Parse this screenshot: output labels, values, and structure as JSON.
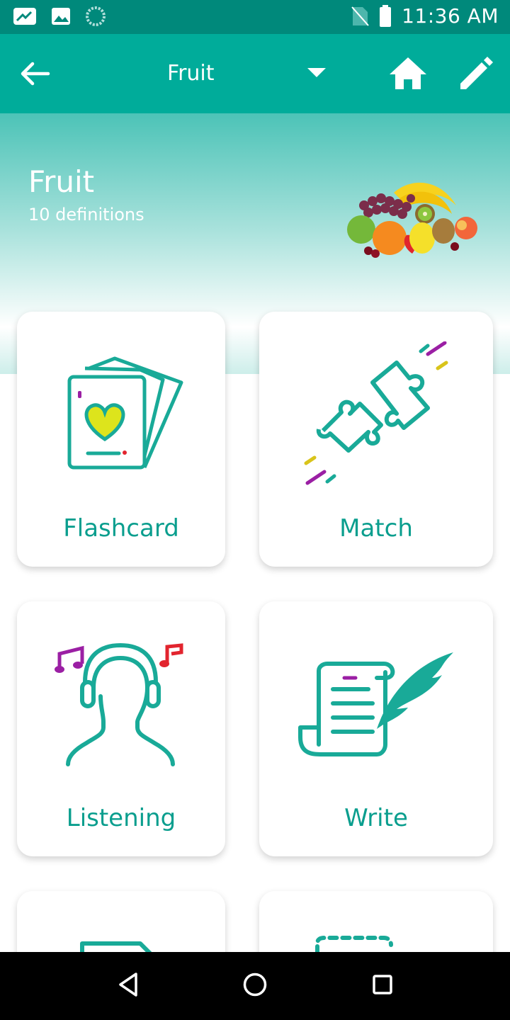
{
  "status_bar": {
    "time": "11:36 AM",
    "icons": [
      "gallery-app-icon",
      "image-icon",
      "loading-icon",
      "no-sim-icon",
      "battery-icon"
    ]
  },
  "app_bar": {
    "title": "Fruit",
    "icons": [
      "back-arrow-icon",
      "dropdown-icon",
      "home-icon",
      "edit-icon"
    ]
  },
  "header": {
    "set_title": "Fruit",
    "definitions_count": "10 definitions"
  },
  "cards": [
    {
      "label": "Flashcard",
      "icon": "flashcard-icon"
    },
    {
      "label": "Match",
      "icon": "puzzle-icon"
    },
    {
      "label": "Listening",
      "icon": "headphones-person-icon"
    },
    {
      "label": "Write",
      "icon": "quill-scroll-icon"
    },
    {
      "label": "",
      "icon": "document-icon"
    },
    {
      "label": "",
      "icon": "dashed-box-icon"
    }
  ],
  "nav_bar": {
    "icons": [
      "back-triangle-icon",
      "home-circle-icon",
      "recents-square-icon"
    ]
  },
  "colors": {
    "status_bar": "#00897b",
    "app_bar": "#00ac9a",
    "accent": "#0a9e8e"
  }
}
